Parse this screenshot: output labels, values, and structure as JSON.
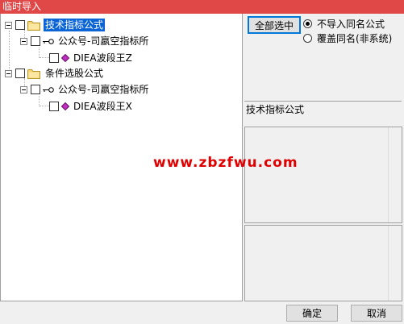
{
  "window": {
    "title": "临时导入"
  },
  "tree": {
    "nodes": [
      {
        "label": "技术指标公式",
        "icon": "folder-icon",
        "selected": true
      },
      {
        "label": "公众号-司嬴空指标所",
        "icon": "key-icon"
      },
      {
        "label": "DIEA波段王Z",
        "icon": "gem-icon"
      },
      {
        "label": "条件选股公式",
        "icon": "folder-icon"
      },
      {
        "label": "公众号-司嬴空指标所",
        "icon": "key-icon"
      },
      {
        "label": "DIEA波段王X",
        "icon": "gem-icon"
      }
    ]
  },
  "right": {
    "select_all_label": "全部选中",
    "options": [
      {
        "label": "不导入同名公式",
        "checked": true
      },
      {
        "label": "覆盖同名(非系统)",
        "checked": false
      }
    ],
    "info_label": "技术指标公式"
  },
  "watermark": "www.zbzfwu.com",
  "footer": {
    "ok_label": "确定",
    "cancel_label": "取消"
  },
  "colors": {
    "titlebar": "#e04848",
    "selection": "#0a64d6",
    "watermark": "#e00000",
    "gem": "#c030c0"
  }
}
